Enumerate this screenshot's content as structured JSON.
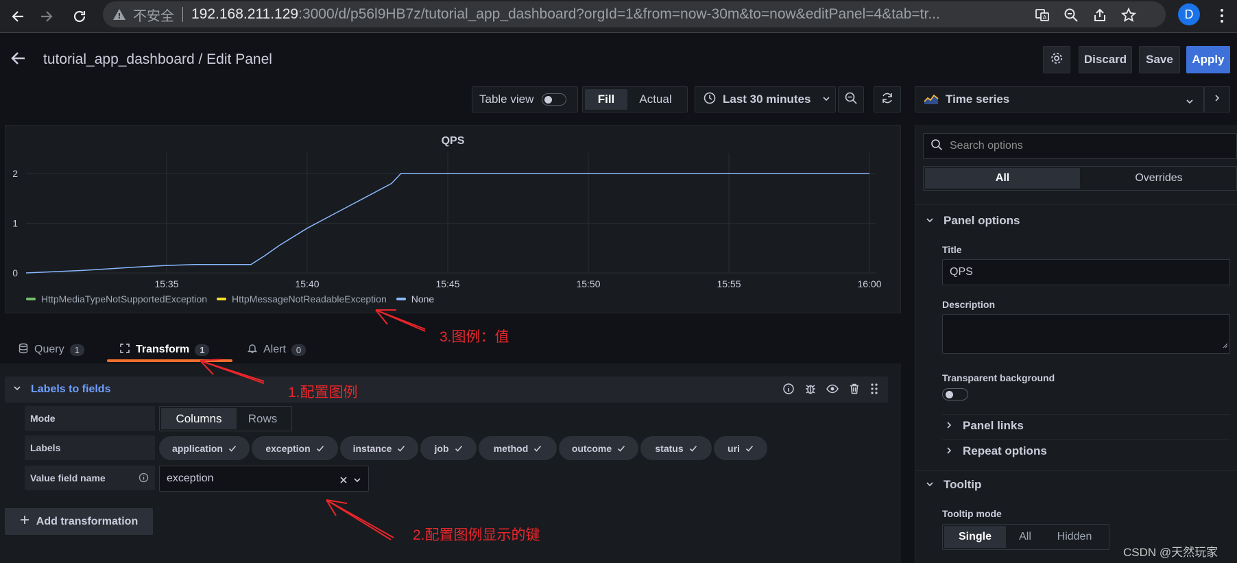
{
  "browser": {
    "insecure_label": "不安全",
    "url_host": "192.168.211.129",
    "url_rest": ":3000/d/p56l9HB7z/tutorial_app_dashboard?orgId=1&from=now-30m&to=now&editPanel=4&tab=tr...",
    "profile_initial": "D"
  },
  "header": {
    "title": "tutorial_app_dashboard / Edit Panel",
    "discard_label": "Discard",
    "save_label": "Save",
    "apply_label": "Apply"
  },
  "toolbar": {
    "table_view_label": "Table view",
    "table_view_on": false,
    "fill_label": "Fill",
    "actual_label": "Actual",
    "time_range": "Last 30 minutes"
  },
  "visualization": {
    "name": "Time series"
  },
  "chart_data": {
    "type": "line",
    "title": "QPS",
    "xlabel": "",
    "ylabel": "",
    "x_ticks": [
      "15:35",
      "15:40",
      "15:45",
      "15:50",
      "15:55",
      "16:00"
    ],
    "y_ticks": [
      "0",
      "1",
      "2"
    ],
    "ylim": [
      0,
      2
    ],
    "x_range": [
      "15:30",
      "16:00"
    ],
    "legend_position": "bottom-left",
    "grid": true,
    "series": [
      {
        "name": "HttpMediaTypeNotSupportedException",
        "color": "#73bf69",
        "x": [],
        "y": []
      },
      {
        "name": "HttpMessageNotReadableException",
        "color": "#fade2a",
        "x": [],
        "y": []
      },
      {
        "name": "None",
        "color": "#8ab8ff",
        "x": [
          "15:30",
          "15:32",
          "15:34",
          "15:35",
          "15:36",
          "15:38",
          "15:38:30",
          "15:39",
          "15:40",
          "15:41",
          "15:42",
          "15:43",
          "15:43:20",
          "15:45",
          "15:50",
          "15:55",
          "16:00"
        ],
        "y": [
          0,
          0.05,
          0.12,
          0.15,
          0.17,
          0.17,
          0.35,
          0.55,
          0.9,
          1.2,
          1.5,
          1.8,
          2,
          2,
          2,
          2,
          2
        ]
      }
    ]
  },
  "tabs": [
    {
      "label": "Query",
      "count": "1"
    },
    {
      "label": "Transform",
      "count": "1"
    },
    {
      "label": "Alert",
      "count": "0"
    }
  ],
  "transform": {
    "name": "Labels to fields",
    "mode_label": "Mode",
    "mode_options": [
      "Columns",
      "Rows"
    ],
    "labels_label": "Labels",
    "labels": [
      "application",
      "exception",
      "instance",
      "job",
      "method",
      "outcome",
      "status",
      "uri"
    ],
    "value_field_label": "Value field name",
    "value_field_value": "exception",
    "add_label": "Add transformation"
  },
  "options": {
    "search_placeholder": "Search options",
    "all_label": "All",
    "overrides_label": "Overrides",
    "panel_options_label": "Panel options",
    "title_label": "Title",
    "title_value": "QPS",
    "description_label": "Description",
    "transparent_label": "Transparent background",
    "panel_links_label": "Panel links",
    "repeat_options_label": "Repeat options",
    "tooltip_label": "Tooltip",
    "tooltip_mode_label": "Tooltip mode",
    "tooltip_modes": [
      "Single",
      "All",
      "Hidden"
    ]
  },
  "annotations": {
    "a1": "1.配置图例",
    "a2": "2.配置图例显示的键",
    "a3": "3.图例：值"
  },
  "watermark": "CSDN @天然玩家"
}
